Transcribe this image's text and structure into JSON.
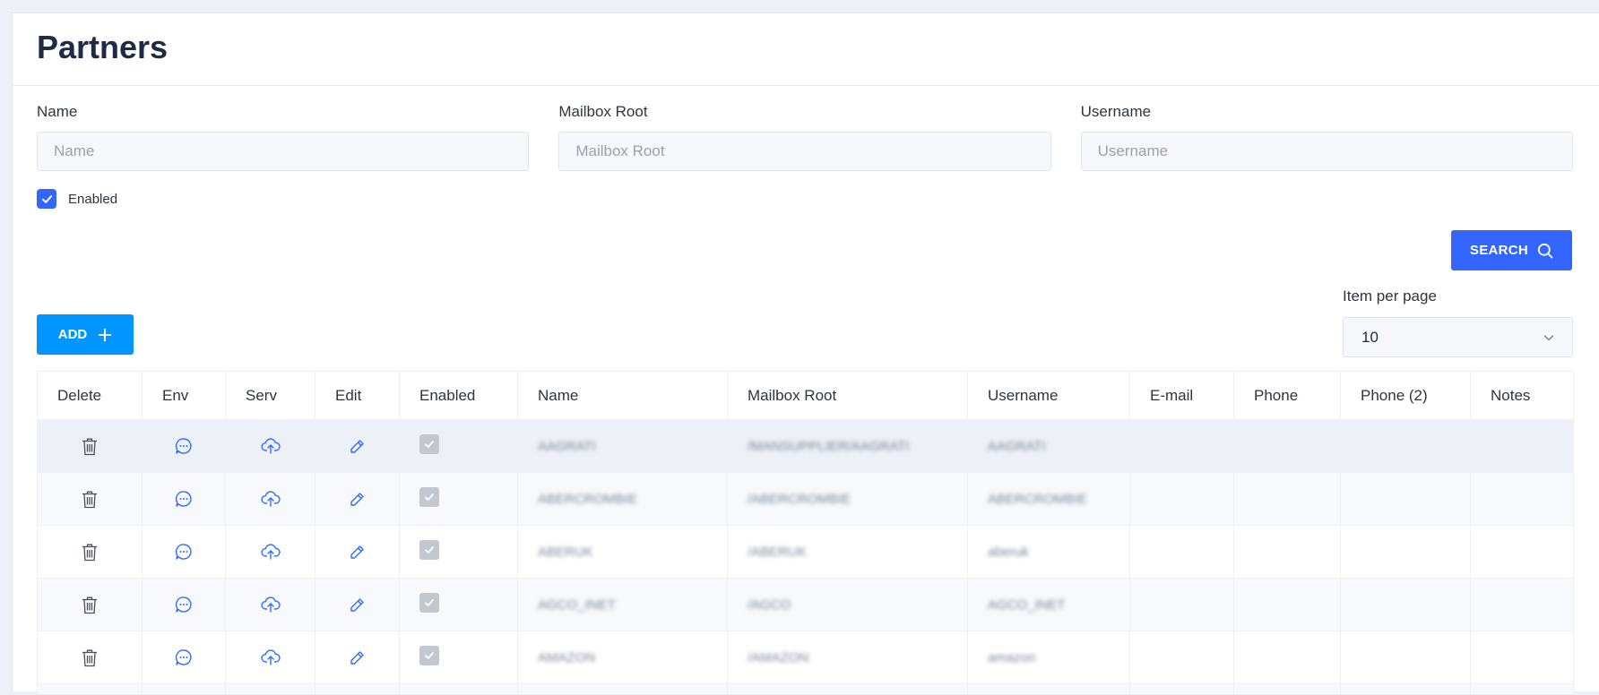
{
  "header": {
    "title": "Partners"
  },
  "filters": {
    "name": {
      "label": "Name",
      "placeholder": "Name"
    },
    "mailbox_root": {
      "label": "Mailbox Root",
      "placeholder": "Mailbox Root"
    },
    "username": {
      "label": "Username",
      "placeholder": "Username"
    },
    "enabled": {
      "label": "Enabled",
      "checked": true
    }
  },
  "actions": {
    "search_label": "SEARCH",
    "add_label": "ADD"
  },
  "pagination": {
    "items_per_page_label": "Item per page",
    "items_per_page_value": "10"
  },
  "colors": {
    "primary": "#3366ff",
    "add_button": "#0095ff",
    "icon": "#2f6bff"
  },
  "table": {
    "columns": [
      "Delete",
      "Env",
      "Serv",
      "Edit",
      "Enabled",
      "Name",
      "Mailbox Root",
      "Username",
      "E-mail",
      "Phone",
      "Phone (2)",
      "Notes"
    ],
    "rows": [
      {
        "name": "AAGRATI",
        "mailbox_root": "/MANSUPPLIER/AAGRATI",
        "username": "AAGRATI",
        "email": "",
        "phone": "",
        "phone2": "",
        "notes": ""
      },
      {
        "name": "ABERCROMBIE",
        "mailbox_root": "/ABERCROMBIE",
        "username": "ABERCROMBIE",
        "email": "",
        "phone": "",
        "phone2": "",
        "notes": ""
      },
      {
        "name": "ABERUK",
        "mailbox_root": "/ABERUK",
        "username": "aberuk",
        "email": "",
        "phone": "",
        "phone2": "",
        "notes": ""
      },
      {
        "name": "AGCO_INET",
        "mailbox_root": "/AGCO",
        "username": "AGCO_INET",
        "email": "",
        "phone": "",
        "phone2": "",
        "notes": ""
      },
      {
        "name": "AMAZON",
        "mailbox_root": "/AMAZON",
        "username": "amazon",
        "email": "",
        "phone": "",
        "phone2": "",
        "notes": ""
      }
    ]
  }
}
